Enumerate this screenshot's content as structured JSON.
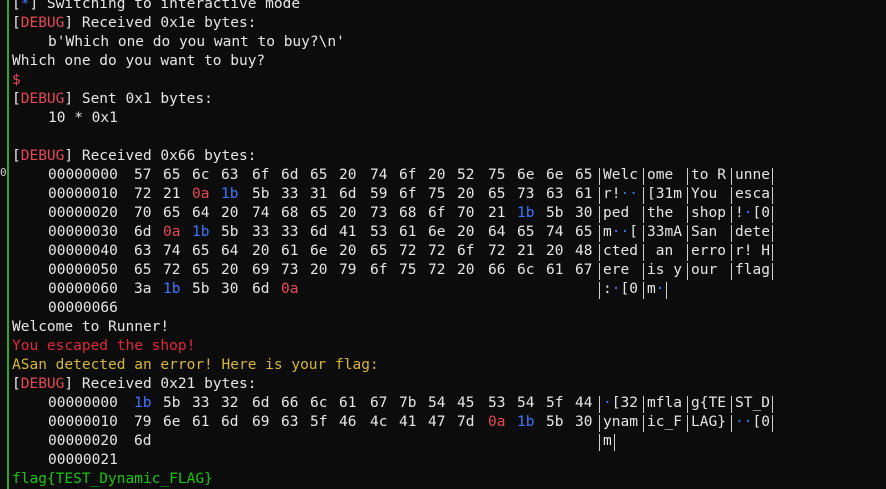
{
  "lines": {
    "switch_prefix": "[",
    "switch_star": "*",
    "switch_suffix": "] Switching to interactive mode",
    "debug_label": "DEBUG",
    "recv1": "] Received 0x1e bytes:",
    "recv1_body": "b'Which one do you want to buy?\\n'",
    "question": "Which one do you want to buy?",
    "prompt": "$",
    "sent": "] Sent 0x1 bytes:",
    "sent_body": "10 * 0x1",
    "recv2": "] Received 0x66 bytes:",
    "end_offset1": "00000066",
    "welcome": "Welcome to Runner!",
    "escaped": "You escaped the shop!",
    "asan": "ASan detected an error! Here is your flag:",
    "recv3": "] Received 0x21 bytes:",
    "end_offset2": "00000021",
    "flag": "flag{TEST_Dynamic_FLAG}",
    "open_bracket": "["
  },
  "dump1": [
    {
      "offset": "00000000",
      "bytes": [
        [
          "57",
          "65",
          "6c",
          "63"
        ],
        [
          "6f",
          "6d",
          "65",
          "20"
        ],
        [
          "74",
          "6f",
          "20",
          "52"
        ],
        [
          "75",
          "6e",
          "6e",
          "65"
        ]
      ],
      "ascii": [
        "Welc",
        "ome ",
        "to R",
        "unne"
      ]
    },
    {
      "offset": "00000010",
      "bytes": [
        [
          "72",
          "21",
          "0a",
          "1b"
        ],
        [
          "5b",
          "33",
          "31",
          "6d"
        ],
        [
          "59",
          "6f",
          "75",
          "20"
        ],
        [
          "65",
          "73",
          "63",
          "61"
        ]
      ],
      "ascii": [
        "r!··",
        "[31m",
        "You ",
        "esca"
      ]
    },
    {
      "offset": "00000020",
      "bytes": [
        [
          "70",
          "65",
          "64",
          "20"
        ],
        [
          "74",
          "68",
          "65",
          "20"
        ],
        [
          "73",
          "68",
          "6f",
          "70"
        ],
        [
          "21",
          "1b",
          "5b",
          "30"
        ]
      ],
      "ascii": [
        "ped ",
        "the ",
        "shop",
        "!·[0"
      ]
    },
    {
      "offset": "00000030",
      "bytes": [
        [
          "6d",
          "0a",
          "1b",
          "5b"
        ],
        [
          "33",
          "33",
          "6d",
          "41"
        ],
        [
          "53",
          "61",
          "6e",
          "20"
        ],
        [
          "64",
          "65",
          "74",
          "65"
        ]
      ],
      "ascii": [
        "m··[",
        "33mA",
        "San ",
        "dete"
      ]
    },
    {
      "offset": "00000040",
      "bytes": [
        [
          "63",
          "74",
          "65",
          "64"
        ],
        [
          "20",
          "61",
          "6e",
          "20"
        ],
        [
          "65",
          "72",
          "72",
          "6f"
        ],
        [
          "72",
          "21",
          "20",
          "48"
        ]
      ],
      "ascii": [
        "cted",
        " an ",
        "erro",
        "r! H"
      ]
    },
    {
      "offset": "00000050",
      "bytes": [
        [
          "65",
          "72",
          "65",
          "20"
        ],
        [
          "69",
          "73",
          "20",
          "79"
        ],
        [
          "6f",
          "75",
          "72",
          "20"
        ],
        [
          "66",
          "6c",
          "61",
          "67"
        ]
      ],
      "ascii": [
        "ere ",
        "is y",
        "our ",
        "flag"
      ]
    },
    {
      "offset": "00000060",
      "bytes": [
        [
          "3a",
          "1b",
          "5b",
          "30"
        ],
        [
          "6d",
          "0a"
        ]
      ],
      "ascii": [
        ":·[0",
        "m·"
      ]
    }
  ],
  "dump2": [
    {
      "offset": "00000000",
      "bytes": [
        [
          "1b",
          "5b",
          "33",
          "32"
        ],
        [
          "6d",
          "66",
          "6c",
          "61"
        ],
        [
          "67",
          "7b",
          "54",
          "45"
        ],
        [
          "53",
          "54",
          "5f",
          "44"
        ]
      ],
      "ascii": [
        "·[32",
        "mfla",
        "g{TE",
        "ST_D"
      ]
    },
    {
      "offset": "00000010",
      "bytes": [
        [
          "79",
          "6e",
          "61",
          "6d"
        ],
        [
          "69",
          "63",
          "5f",
          "46"
        ],
        [
          "4c",
          "41",
          "47",
          "7d"
        ],
        [
          "0a",
          "1b",
          "5b",
          "30"
        ]
      ],
      "ascii": [
        "ynam",
        "ic_F",
        "LAG}",
        "··[0"
      ]
    },
    {
      "offset": "00000020",
      "bytes": [
        [
          "6d"
        ]
      ],
      "ascii": [
        "m"
      ]
    }
  ],
  "colors": {
    "background": "#0c0c0c",
    "text": "#e6e6e6",
    "debug_red": "#e74856",
    "star_blue": "#3b78ff",
    "byte_0a": "#e74856",
    "byte_1b": "#3b78ff",
    "yellow": "#d7b73a",
    "green": "#16c60c",
    "side_bar": "#2da829"
  },
  "left_margin_glyph": "0"
}
